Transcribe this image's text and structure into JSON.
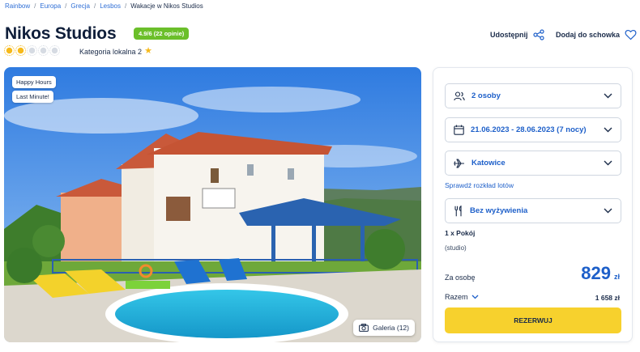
{
  "breadcrumb": {
    "items": [
      "Rainbow",
      "Europa",
      "Grecja",
      "Lesbos"
    ],
    "current": "Wakacje w Nikos Studios"
  },
  "hotel": {
    "name": "Nikos Studios",
    "rating_badge": "4.9/6 (22 opinie)",
    "suns_filled": 2,
    "suns_total": 5,
    "category_label": "Kategoria lokalna 2"
  },
  "actions": {
    "share_label": "Udostępnij",
    "favorite_label": "Dodaj do schowka"
  },
  "photo": {
    "tags": [
      "Happy Hours",
      "Last Minute!"
    ],
    "gallery_label": "Galeria (12)"
  },
  "booking": {
    "persons": "2 osoby",
    "dates": "21.06.2023 - 28.06.2023 (7 nocy)",
    "departure": "Katowice",
    "flight_schedule_link": "Sprawdź rozkład lotów",
    "board": "Bez wyżywienia",
    "room_count": "1 x Pokój",
    "room_type": "(studio)",
    "per_person_label": "Za osobę",
    "price_per_person": "829",
    "currency": "zł",
    "total_label": "Razem",
    "total_value": "1 658 zł",
    "book_button": "REZERWUJ"
  },
  "colors": {
    "accent_blue": "#1d5fc9",
    "rating_green": "#6bbf2a",
    "book_yellow": "#f7d12d",
    "sun_yellow": "#f6b91a"
  }
}
